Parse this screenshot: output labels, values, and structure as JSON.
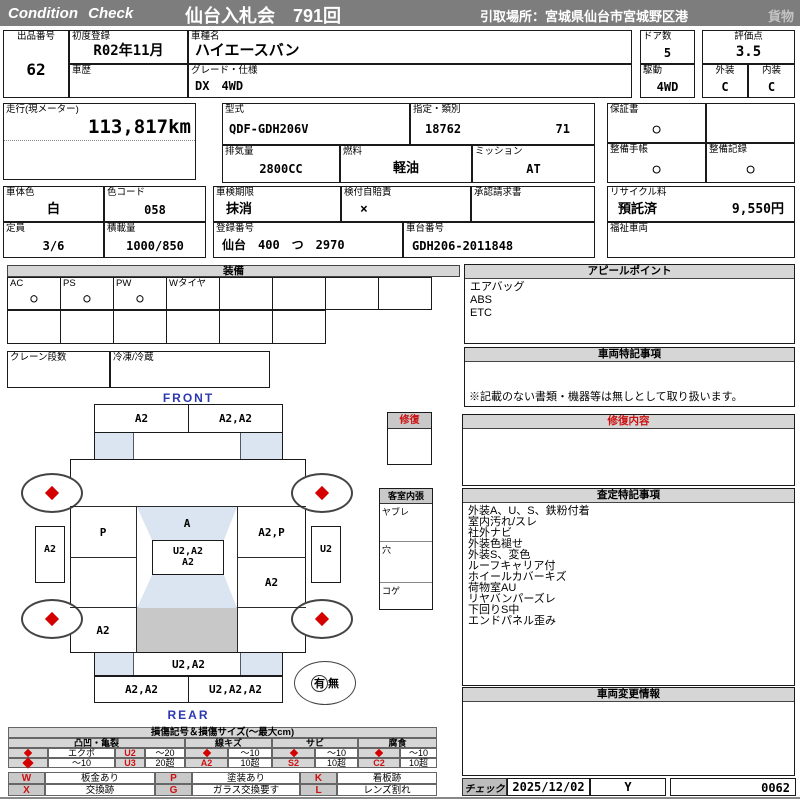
{
  "colors": {
    "accent_red": "#cc1111",
    "header_gray": "#7d7d7d",
    "shade_blue": "#dbe5f1",
    "shade_gray": "#c8c8c8",
    "front_rear_blue": "#2b39b0"
  },
  "header": {
    "brand": "Condition  Check",
    "auction": "仙台入札会　791回",
    "pickup": "引取場所：宮城県仙台市宮城野区港",
    "category": "貨物"
  },
  "info": {
    "exhibit_no_label": "出品番号",
    "exhibit_no": "62",
    "first_reg_label": "初度登録",
    "first_reg": "R02年11月",
    "model_name_label": "車種名",
    "model_name": "ハイエースバン",
    "history_label": "車歴",
    "history": "",
    "grade_label": "グレード・仕様",
    "grade": "DX　4WD",
    "doors_label": "ドア数",
    "doors": "5",
    "score_label": "評価点",
    "score": "3.5",
    "drive_label": "駆動",
    "drive": "4WD",
    "exterior_label": "外装",
    "exterior": "C",
    "interior_label": "内装",
    "interior": "C",
    "mileage_label": "走行(現メーター)",
    "mileage": "113,817km",
    "model_code_label": "型式",
    "model_code": "QDF-GDH206V",
    "class_label": "指定・類別",
    "class_no1": "18762",
    "class_no2": "71",
    "displacement_label": "排気量",
    "displacement": "2800CC",
    "fuel_label": "燃料",
    "fuel": "軽油",
    "transmission_label": "ミッション",
    "transmission": "AT",
    "warranty_label": "保証書",
    "warranty": "○",
    "maintenance_book_label": "整備手帳",
    "maintenance_book": "○",
    "maintenance_record_label": "整備記録",
    "maintenance_record": "○",
    "body_color_label": "車体色",
    "body_color": "白",
    "color_code_label": "色コード",
    "color_code": "058",
    "capacity_label": "定員",
    "capacity": "3/6",
    "load_label": "積載量",
    "load": "1000/850",
    "inspection_label": "車検期限",
    "inspection": "抹消",
    "insurance_label": "検付自賠責",
    "insurance": "×",
    "approval_label": "承認請求書",
    "approval": "",
    "recycle_label": "リサイクル料",
    "recycle_status": "預託済",
    "recycle_fee": "9,550円",
    "reg_no_label": "登録番号",
    "reg_no": "仙台　400　つ　2970",
    "chassis_label": "車台番号",
    "chassis": "GDH206-2011848",
    "welfare_label": "福祉車両"
  },
  "equipment": {
    "title": "装備",
    "row1": [
      {
        "label": "AC",
        "value": "○"
      },
      {
        "label": "PS",
        "value": "○"
      },
      {
        "label": "PW",
        "value": "○"
      },
      {
        "label": "Wタイヤ",
        "value": ""
      },
      {
        "label": "",
        "value": ""
      },
      {
        "label": "",
        "value": ""
      },
      {
        "label": "",
        "value": ""
      },
      {
        "label": "",
        "value": ""
      }
    ],
    "crane_label": "クレーン段数",
    "fridge_label": "冷凍/冷蔵"
  },
  "appeal": {
    "title": "アピールポイント",
    "items": [
      "エアバッグ",
      "ABS",
      "ETC"
    ]
  },
  "vehicle_notes": {
    "title": "車両特記事項",
    "note": "※記載のない書類・機器等は無しとして取り扱います。"
  },
  "repair": {
    "title": "修復内容"
  },
  "assessment": {
    "title": "査定特記事項",
    "items": [
      "外装A、U、S、鉄粉付着",
      "室内汚れ/スレ",
      "社外ナビ",
      "外装色褪せ",
      "外装S、変色",
      "ルーフキャリア付",
      "ホイールカバーキズ",
      "荷物室AU",
      "リヤバンパーズレ",
      "下回りS中",
      "エンドパネル歪み"
    ]
  },
  "change_info": {
    "title": "車両変更情報"
  },
  "check": {
    "label": "チェック",
    "date": "2025/12/02",
    "inspector": "Y",
    "number": "0062"
  },
  "diagram": {
    "front": "FRONT",
    "rear": "REAR",
    "hood_left": "A2",
    "hood_right": "A2,A2",
    "door_front_left": "P",
    "roof_front": "A",
    "door_front_right": "A2,P",
    "center_top": "U2,A2",
    "center_bottom": "A2",
    "door_rear_right": "A2",
    "quarter_left": "A2",
    "side_left": "A2",
    "side_right": "U2",
    "tailgate": "U2,A2",
    "rear_left": "A2,A2",
    "rear_right": "U2,A2,A2",
    "repair_title": "修復",
    "cabin_title": "客室内張",
    "cabin_rows": [
      "ヤブレ",
      "穴",
      "コゲ"
    ],
    "spare_yes": "有",
    "spare_no": "無"
  },
  "legend": {
    "title": "損傷記号＆損傷サイズ(〜最大cm)",
    "groups": [
      "凸凹・亀裂",
      "線キズ",
      "サビ",
      "腐食"
    ],
    "dent_r1_label": "エクボ",
    "dent_r1_code": "U2",
    "dent_r1_size": "〜20",
    "dent_r2_label": "〜10",
    "dent_r2_code": "U3",
    "dent_r2_size": "20超",
    "scratch_r1_size": "〜10",
    "scratch_code": "A2",
    "scratch_r2_size": "10超",
    "rust_r1_size": "〜10",
    "rust_code": "S2",
    "rust_r2_size": "10超",
    "corr_r1_size": "〜10",
    "corr_code": "C2",
    "corr_r2_size": "10超",
    "codes": [
      {
        "code": "W",
        "desc": "板金あり"
      },
      {
        "code": "P",
        "desc": "塗装あり"
      },
      {
        "code": "K",
        "desc": "看板跡"
      },
      {
        "code": "X",
        "desc": "交換跡"
      },
      {
        "code": "G",
        "desc": "ガラス交換要す"
      },
      {
        "code": "L",
        "desc": "レンズ割れ"
      }
    ]
  }
}
